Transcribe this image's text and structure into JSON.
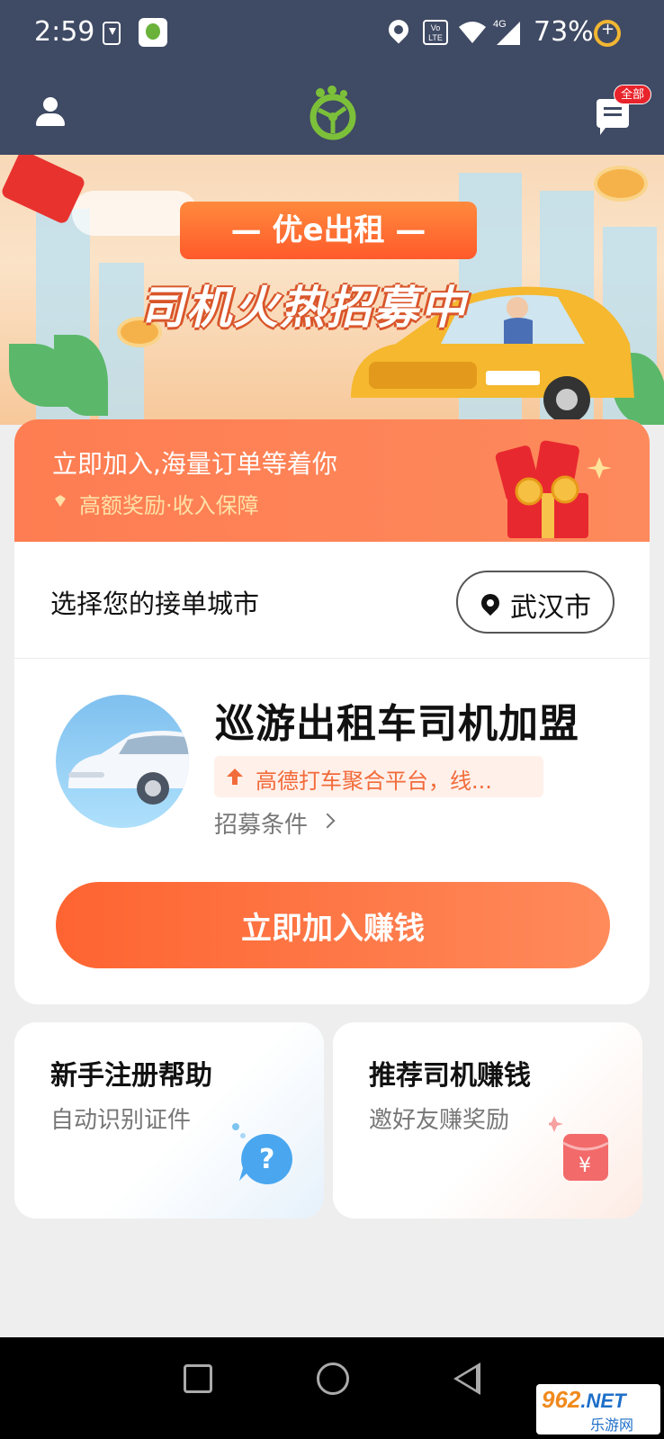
{
  "status_bar": {
    "time": "2:59",
    "network_label": "Vo LTE",
    "signal_label": "4G",
    "battery": "73%"
  },
  "header": {
    "message_badge": "全部"
  },
  "banner": {
    "brand_ribbon": "— 优e出租 —",
    "slogan": "司机火热招募中"
  },
  "promo": {
    "title": "立即加入,海量订单等着你",
    "subtitle": "高额奖励·收入保障"
  },
  "city": {
    "label": "选择您的接单城市",
    "selected": "武汉市"
  },
  "job": {
    "title": "巡游出租车司机加盟",
    "tag": "高德打车聚合平台，线...",
    "conditions_link": "招募条件",
    "join_button": "立即加入赚钱"
  },
  "cards": {
    "help": {
      "title": "新手注册帮助",
      "subtitle": "自动识别证件"
    },
    "refer": {
      "title": "推荐司机赚钱",
      "subtitle": "邀好友赚奖励"
    }
  },
  "watermark": {
    "main": "962",
    "net": ".NET",
    "sub": "乐游网"
  },
  "colors": {
    "header_bg": "#3f4a64",
    "accent_orange": "#fe6431",
    "promo_gold": "#ffe1a8"
  }
}
